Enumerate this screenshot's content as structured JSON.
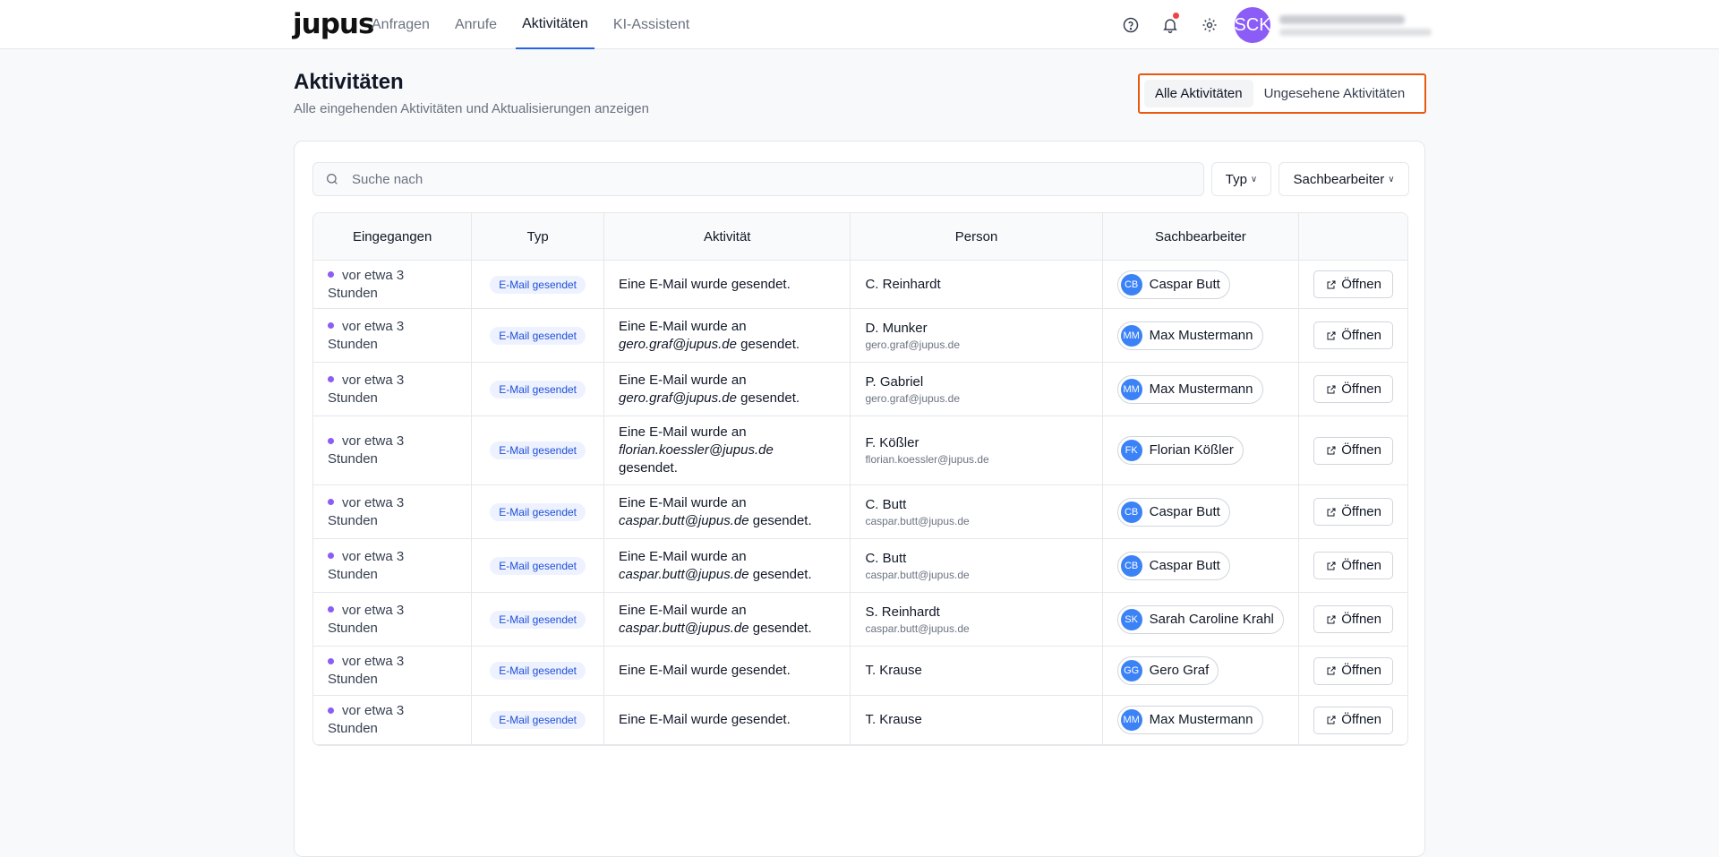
{
  "header": {
    "logo": "jupus",
    "nav": [
      {
        "label": "Anfragen"
      },
      {
        "label": "Anrufe"
      },
      {
        "label": "Aktivitäten"
      },
      {
        "label": "KI-Assistent"
      }
    ],
    "active_nav": "Aktivitäten",
    "user_initials": "SCK"
  },
  "page": {
    "title": "Aktivitäten",
    "subtitle": "Alle eingehenden Aktivitäten und Aktualisierungen anzeigen",
    "segments": [
      "Alle Aktivitäten",
      "Ungesehene Aktivitäten"
    ]
  },
  "filters": {
    "search_placeholder": "Suche nach",
    "typ": "Typ",
    "sachbearbeiter": "Sachbearbeiter"
  },
  "table": {
    "columns": [
      "Eingegangen",
      "Typ",
      "Aktivität",
      "Person",
      "Sachbearbeiter",
      ""
    ],
    "open_label": "Öffnen",
    "rows": [
      {
        "time": "vor etwa 3 Stunden",
        "type": "E-Mail gesendet",
        "pre": "Eine E-Mail wurde gesendet.",
        "mail": "",
        "post": "",
        "person": "C. Reinhardt",
        "person_mail": "",
        "ini": "CB",
        "sb": "Caspar Butt"
      },
      {
        "time": "vor etwa 3 Stunden",
        "type": "E-Mail gesendet",
        "pre": "Eine E-Mail wurde an",
        "mail": "gero.graf@jupus.de",
        "post": "gesendet.",
        "person": "D. Munker",
        "person_mail": "gero.graf@jupus.de",
        "ini": "MM",
        "sb": "Max Mustermann"
      },
      {
        "time": "vor etwa 3 Stunden",
        "type": "E-Mail gesendet",
        "pre": "Eine E-Mail wurde an",
        "mail": "gero.graf@jupus.de",
        "post": "gesendet.",
        "person": "P. Gabriel",
        "person_mail": "gero.graf@jupus.de",
        "ini": "MM",
        "sb": "Max Mustermann"
      },
      {
        "time": "vor etwa 3 Stunden",
        "type": "E-Mail gesendet",
        "pre": "Eine E-Mail wurde an",
        "mail": "florian.koessler@jupus.de",
        "post": "gesendet.",
        "person": "F. Kößler",
        "person_mail": "florian.koessler@jupus.de",
        "ini": "FK",
        "sb": "Florian Kößler"
      },
      {
        "time": "vor etwa 3 Stunden",
        "type": "E-Mail gesendet",
        "pre": "Eine E-Mail wurde an",
        "mail": "caspar.butt@jupus.de",
        "post": "gesendet.",
        "person": "C. Butt",
        "person_mail": "caspar.butt@jupus.de",
        "ini": "CB",
        "sb": "Caspar Butt"
      },
      {
        "time": "vor etwa 3 Stunden",
        "type": "E-Mail gesendet",
        "pre": "Eine E-Mail wurde an",
        "mail": "caspar.butt@jupus.de",
        "post": "gesendet.",
        "person": "C. Butt",
        "person_mail": "caspar.butt@jupus.de",
        "ini": "CB",
        "sb": "Caspar Butt"
      },
      {
        "time": "vor etwa 3 Stunden",
        "type": "E-Mail gesendet",
        "pre": "Eine E-Mail wurde an",
        "mail": "caspar.butt@jupus.de",
        "post": "gesendet.",
        "person": "S. Reinhardt",
        "person_mail": "caspar.butt@jupus.de",
        "ini": "SK",
        "sb": "Sarah Caroline Krahl"
      },
      {
        "time": "vor etwa 3 Stunden",
        "type": "E-Mail gesendet",
        "pre": "Eine E-Mail wurde gesendet.",
        "mail": "",
        "post": "",
        "person": "T. Krause",
        "person_mail": "",
        "ini": "GG",
        "sb": "Gero Graf"
      },
      {
        "time": "vor etwa 3 Stunden",
        "type": "E-Mail gesendet",
        "pre": "Eine E-Mail wurde gesendet.",
        "mail": "",
        "post": "",
        "person": "T. Krause",
        "person_mail": "",
        "ini": "MM",
        "sb": "Max Mustermann"
      }
    ]
  },
  "colors": {
    "accent": "#2563eb",
    "highlight_border": "#ea580c",
    "unread_dot": "#8b5cf6",
    "avatar": "#3b82f6"
  }
}
